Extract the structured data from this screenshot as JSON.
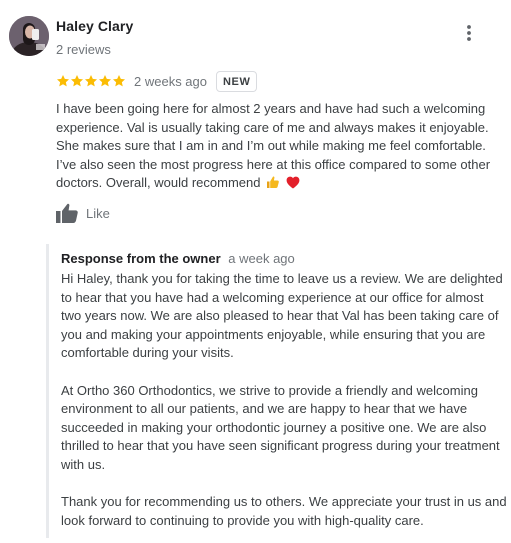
{
  "reviewer": {
    "name": "Haley Clary",
    "review_count": "2 reviews"
  },
  "rating": {
    "stars": 5,
    "max": 5,
    "color": "#fbbc04"
  },
  "review": {
    "date": "2 weeks ago",
    "badge": "NEW",
    "text": "I have been going here for almost 2 years and have had such a welcoming experience. Val is usually taking care of me and always makes it enjoyable. She makes sure that I am in and I’m out while making me feel comfortable. I’ve also seen the most progress here at this office compared to some other doctors. Overall, would recommend",
    "emojis": [
      "thumbs-up-emoji",
      "red-heart-emoji"
    ]
  },
  "actions": {
    "like_label": "Like",
    "more_icon": "more-vert-icon"
  },
  "owner_response": {
    "title": "Response from the owner",
    "date": "a week ago",
    "paragraphs": [
      "Hi Haley, thank you for taking the time to leave us a review. We are delighted to hear that you have had a welcoming experience at our office for almost two years now. We are also pleased to hear that Val has been taking care of you and making your appointments enjoyable, while ensuring that you are comfortable during your visits.",
      "At Ortho 360 Orthodontics, we strive to provide a friendly and welcoming environment to all our patients, and we are happy to hear that we have succeeded in making your orthodontic journey a positive one. We are also thrilled to hear that you have seen significant progress during your treatment with us.",
      "Thank you for recommending us to others. We appreciate your trust in us and look forward to continuing to provide you with high-quality care."
    ]
  },
  "colors": {
    "text_primary": "#202124",
    "text_secondary": "#70757a",
    "body_text": "#3c4043",
    "response_border": "#e8eaed"
  }
}
